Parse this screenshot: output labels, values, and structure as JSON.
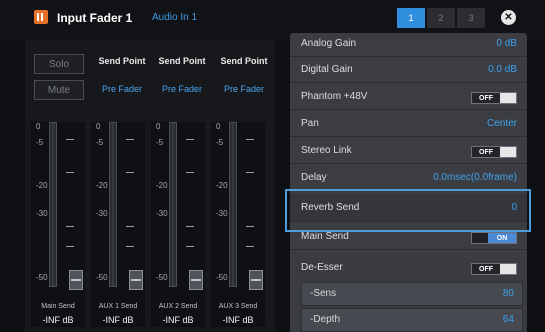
{
  "header": {
    "title": "Input Fader 1",
    "subtitle": "Audio In 1",
    "tabs": [
      "1",
      "2",
      "3"
    ]
  },
  "mixer": {
    "solo_label": "Solo",
    "mute_label": "Mute",
    "columns": [
      {
        "heading": "Send Point",
        "subheading": "Pre Fader"
      },
      {
        "heading": "Send Point",
        "subheading": "Pre Fader"
      },
      {
        "heading": "Send Point",
        "subheading": "Pre Fader"
      }
    ],
    "faders": [
      {
        "label": "Main Send",
        "value": "-INF dB"
      },
      {
        "label": "AUX 1 Send",
        "value": "-INF dB"
      },
      {
        "label": "AUX 2 Send",
        "value": "-INF dB"
      },
      {
        "label": "AUX 3 Send",
        "value": "-INF dB"
      }
    ],
    "scale": [
      "0",
      "-5",
      "-20",
      "-30",
      "-50"
    ]
  },
  "settings": {
    "rows": [
      {
        "label": "Analog Gain",
        "value": "0 dB"
      },
      {
        "label": "Digital Gain",
        "value": "0.0 dB"
      },
      {
        "label": "Phantom +48V",
        "toggle": "OFF"
      },
      {
        "label": "Pan",
        "value": "Center"
      },
      {
        "label": "Stereo Link",
        "toggle": "OFF"
      },
      {
        "label": "Delay",
        "value": "0.0msec(0.0frame)"
      },
      {
        "label": "Reverb Send",
        "value": "0"
      },
      {
        "label": "Main Send",
        "toggle": "ON"
      }
    ],
    "deesser": {
      "label": "De-Esser",
      "toggle": "OFF",
      "sens_label": "-Sens",
      "sens_value": "80",
      "depth_label": "-Depth",
      "depth_value": "64"
    }
  },
  "colors": {
    "accent": "#2f8ede",
    "value": "#3ea2ef",
    "highlight": "#4d9cdc"
  }
}
